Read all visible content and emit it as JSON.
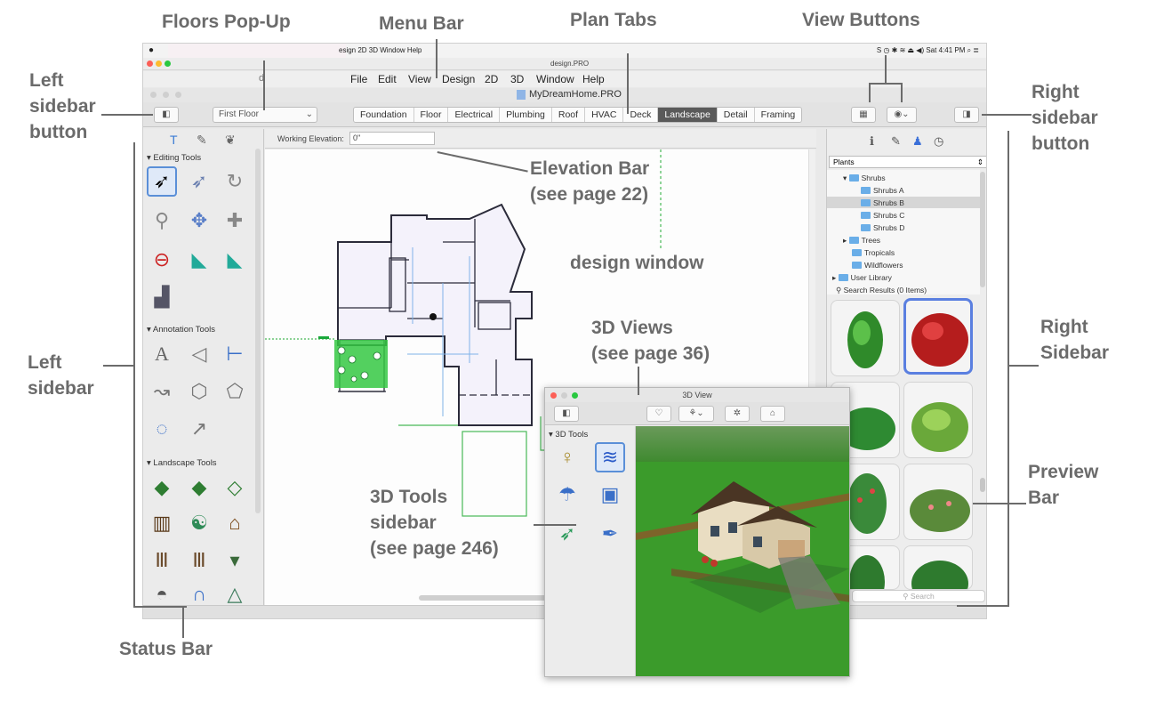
{
  "callouts": {
    "floors_popup": "Floors Pop-Up",
    "menu_bar": "Menu Bar",
    "plan_tabs": "Plan Tabs",
    "view_buttons": "View Buttons",
    "left_sidebar_button": "Left\nsidebar\nbutton",
    "right_sidebar_button": "Right\nsidebar\nbutton",
    "elevation_bar": "Elevation Bar\n(see page 22)",
    "design_window": "design window",
    "views_3d": "3D Views\n(see page 36)",
    "left_sidebar": "Left\nsidebar",
    "right_sidebar": "Right\nSidebar",
    "preview_bar": "Preview\nBar",
    "tools_3d": "3D Tools\nsidebar\n(see page 246)",
    "status_bar": "Status Bar"
  },
  "os_menubar": {
    "items": "esign   2D   3D   Window   Help",
    "right": "S  ◷  ✱  ≋  ⏏  ◀)   Sat 4:41 PM   ⌕  ≣"
  },
  "window": {
    "title": "design.PRO",
    "doc_title": "MyDreamHome.PRO"
  },
  "app_menu": [
    "File",
    "Edit",
    "View",
    "Design",
    "2D",
    "3D",
    "Window",
    "Help"
  ],
  "floors_popup_value": "First Floor",
  "plan_tabs": [
    "Foundation",
    "Floor",
    "Electrical",
    "Plumbing",
    "Roof",
    "HVAC",
    "Deck",
    "Landscape",
    "Detail",
    "Framing"
  ],
  "active_tab": "Landscape",
  "elevation": {
    "label": "Working Elevation:",
    "value": "0\""
  },
  "left_sidebar": {
    "editing_tools": "Editing Tools",
    "annotation_tools": "Annotation Tools",
    "landscape_tools": "Landscape Tools"
  },
  "right_sidebar": {
    "category": "Plants",
    "tree": [
      "Shrubs",
      "Shrubs A",
      "Shrubs B",
      "Shrubs C",
      "Shrubs D",
      "Trees",
      "Tropicals",
      "Wildflowers",
      "User Library",
      "Search Results (0 Items)"
    ],
    "search_placeholder": "Search"
  },
  "view3d": {
    "title": "3D View",
    "tools_header": "3D Tools"
  },
  "colors": {
    "accent": "#5a8fd8",
    "callout": "#6b6b6b",
    "active_tab": "#5a5a5a"
  }
}
